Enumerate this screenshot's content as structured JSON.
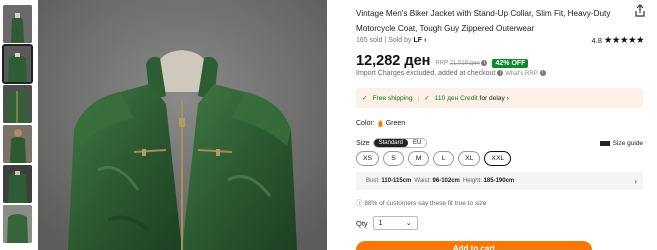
{
  "product": {
    "title": "Vintage Men's Biker Jacket with Stand-Up Collar, Slim Fit, Heavy-Duty Motorcycle Coat, Tough Guy Zippered Outerwear",
    "sold_count": "165 sold",
    "sold_by_label": "Sold by",
    "seller": "LF",
    "rating": "4.8",
    "stars": "★★★★★"
  },
  "pricing": {
    "price": "12,282 ден",
    "rrp_label": "RRP",
    "rrp_value": "21,519 ден",
    "discount_badge": "42% OFF",
    "import_note": "Import Charges excluded, added at checkout",
    "whats_rrp": "What's RRP"
  },
  "promo": {
    "free_shipping": "Free shipping",
    "credit": "110 ден Credit",
    "credit_suffix": "for delay",
    "credit_chevron": "›"
  },
  "color": {
    "label": "Color:",
    "value": "Green"
  },
  "size": {
    "label": "Size",
    "standard_tab": "Standard",
    "eu_tab": "EU",
    "size_guide": "Size guide",
    "options": [
      "XS",
      "S",
      "M",
      "L",
      "XL",
      "XXL"
    ],
    "selected": "XXL",
    "measure_bust_label": "Bust:",
    "measure_bust": "110-115cm",
    "measure_waist_label": "Waist:",
    "measure_waist": "96-102cm",
    "measure_height_label": "Height:",
    "measure_height": "185-190cm",
    "fit_note": "88% of customers say these fit true to size"
  },
  "quantity": {
    "label": "Qty",
    "value": "1",
    "chevron": "⌄"
  },
  "cart": {
    "add_label": "Add to cart"
  },
  "colors": {
    "accent": "#fb7701",
    "discount": "#0a8a2a",
    "promo_bg": "#fdf0e6"
  }
}
